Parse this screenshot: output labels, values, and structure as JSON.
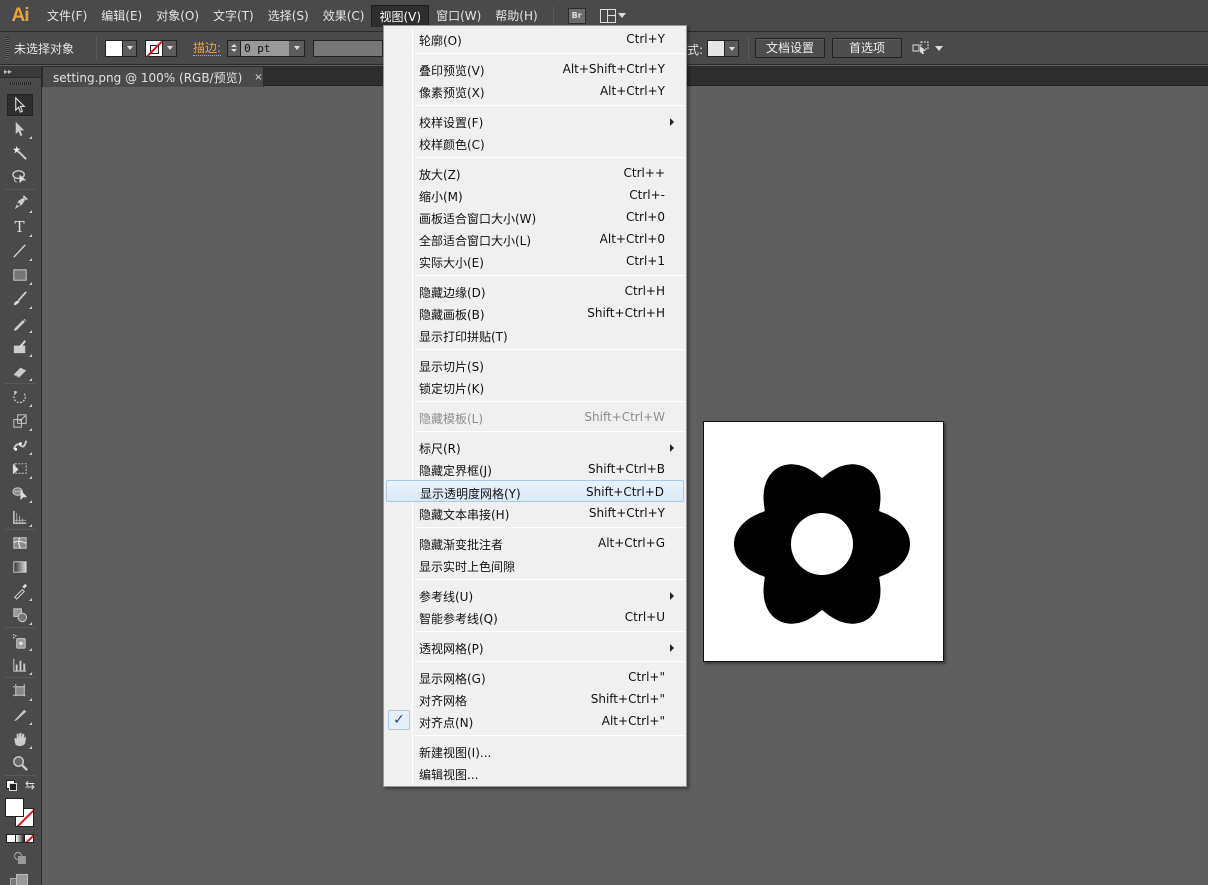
{
  "app": {
    "logo": "Ai",
    "menubar": [
      {
        "label": "文件(F)"
      },
      {
        "label": "编辑(E)"
      },
      {
        "label": "对象(O)"
      },
      {
        "label": "文字(T)"
      },
      {
        "label": "选择(S)"
      },
      {
        "label": "效果(C)"
      },
      {
        "label": "视图(V)",
        "active": true
      },
      {
        "label": "窗口(W)"
      },
      {
        "label": "帮助(H)"
      }
    ],
    "bridge_button": "Br",
    "workspace_icon": "workspace-layout-icon"
  },
  "controlbar": {
    "selection_status": "未选择对象",
    "fill_color": "#ffffff",
    "stroke_color": "none",
    "stroke_label": "描边:",
    "stroke_weight": "0 pt",
    "style_label": "式:",
    "doc_setup_button": "文档设置",
    "preferences_button": "首选项",
    "isolate_icon": "isolate-mode-icon",
    "accent_color": "#e8a33a"
  },
  "document_tab": {
    "title": "setting.png @ 100% (RGB/预览)",
    "close": "×"
  },
  "toolbar": {
    "collapse": "▸▸",
    "tools": [
      {
        "name": "selection-tool",
        "selected": true
      },
      {
        "name": "direct-selection-tool"
      },
      {
        "name": "magic-wand-tool"
      },
      {
        "name": "lasso-tool"
      },
      {
        "name": "pen-tool"
      },
      {
        "name": "type-tool"
      },
      {
        "name": "line-segment-tool"
      },
      {
        "name": "rectangle-tool"
      },
      {
        "name": "paintbrush-tool"
      },
      {
        "name": "pencil-tool"
      },
      {
        "name": "blob-brush-tool"
      },
      {
        "name": "eraser-tool"
      },
      {
        "name": "rotate-tool"
      },
      {
        "name": "scale-tool"
      },
      {
        "name": "warp-tool"
      },
      {
        "name": "free-transform-tool"
      },
      {
        "name": "shape-builder-tool"
      },
      {
        "name": "perspective-grid-tool"
      },
      {
        "name": "mesh-tool"
      },
      {
        "name": "gradient-tool"
      },
      {
        "name": "eyedropper-tool"
      },
      {
        "name": "blend-tool"
      },
      {
        "name": "symbol-sprayer-tool"
      },
      {
        "name": "column-graph-tool"
      },
      {
        "name": "artboard-tool"
      },
      {
        "name": "slice-tool"
      },
      {
        "name": "hand-tool"
      },
      {
        "name": "zoom-tool"
      }
    ],
    "fill_color": "#ffffff",
    "stroke_color": "none"
  },
  "artboard": {
    "content": "gear-icon",
    "teeth": 6,
    "background": "#ffffff",
    "shape_color": "#000000"
  },
  "view_menu": {
    "items": [
      {
        "label": "轮廓(O)",
        "shortcut": "Ctrl+Y"
      },
      {
        "sep": true
      },
      {
        "label": "叠印预览(V)",
        "shortcut": "Alt+Shift+Ctrl+Y"
      },
      {
        "label": "像素预览(X)",
        "shortcut": "Alt+Ctrl+Y"
      },
      {
        "sep": true
      },
      {
        "label": "校样设置(F)",
        "shortcut": "",
        "submenu": true
      },
      {
        "label": "校样颜色(C)",
        "shortcut": ""
      },
      {
        "sep": true
      },
      {
        "label": "放大(Z)",
        "shortcut": "Ctrl++"
      },
      {
        "label": "缩小(M)",
        "shortcut": "Ctrl+-"
      },
      {
        "label": "画板适合窗口大小(W)",
        "shortcut": "Ctrl+0"
      },
      {
        "label": "全部适合窗口大小(L)",
        "shortcut": "Alt+Ctrl+0"
      },
      {
        "label": "实际大小(E)",
        "shortcut": "Ctrl+1"
      },
      {
        "sep": true
      },
      {
        "label": "隐藏边缘(D)",
        "shortcut": "Ctrl+H"
      },
      {
        "label": "隐藏画板(B)",
        "shortcut": "Shift+Ctrl+H"
      },
      {
        "label": "显示打印拼贴(T)",
        "shortcut": ""
      },
      {
        "sep": true
      },
      {
        "label": "显示切片(S)",
        "shortcut": ""
      },
      {
        "label": "锁定切片(K)",
        "shortcut": ""
      },
      {
        "sep": true
      },
      {
        "label": "隐藏模板(L)",
        "shortcut": "Shift+Ctrl+W",
        "disabled": true
      },
      {
        "sep": true
      },
      {
        "label": "标尺(R)",
        "shortcut": "",
        "submenu": true
      },
      {
        "label": "隐藏定界框(J)",
        "shortcut": "Shift+Ctrl+B"
      },
      {
        "label": "显示透明度网格(Y)",
        "shortcut": "Shift+Ctrl+D",
        "highlighted": true
      },
      {
        "label": "隐藏文本串接(H)",
        "shortcut": "Shift+Ctrl+Y"
      },
      {
        "sep": true
      },
      {
        "label": "隐藏渐变批注者",
        "shortcut": "Alt+Ctrl+G"
      },
      {
        "label": "显示实时上色间隙",
        "shortcut": ""
      },
      {
        "sep": true
      },
      {
        "label": "参考线(U)",
        "shortcut": "",
        "submenu": true
      },
      {
        "label": "智能参考线(Q)",
        "shortcut": "Ctrl+U"
      },
      {
        "sep": true
      },
      {
        "label": "透视网格(P)",
        "shortcut": "",
        "submenu": true
      },
      {
        "sep": true
      },
      {
        "label": "显示网格(G)",
        "shortcut": "Ctrl+\""
      },
      {
        "label": "对齐网格",
        "shortcut": "Shift+Ctrl+\""
      },
      {
        "label": "对齐点(N)",
        "shortcut": "Alt+Ctrl+\"",
        "checked": true
      },
      {
        "sep": true
      },
      {
        "label": "新建视图(I)...",
        "shortcut": ""
      },
      {
        "label": "编辑视图...",
        "shortcut": ""
      }
    ],
    "check_glyph": "✓"
  }
}
